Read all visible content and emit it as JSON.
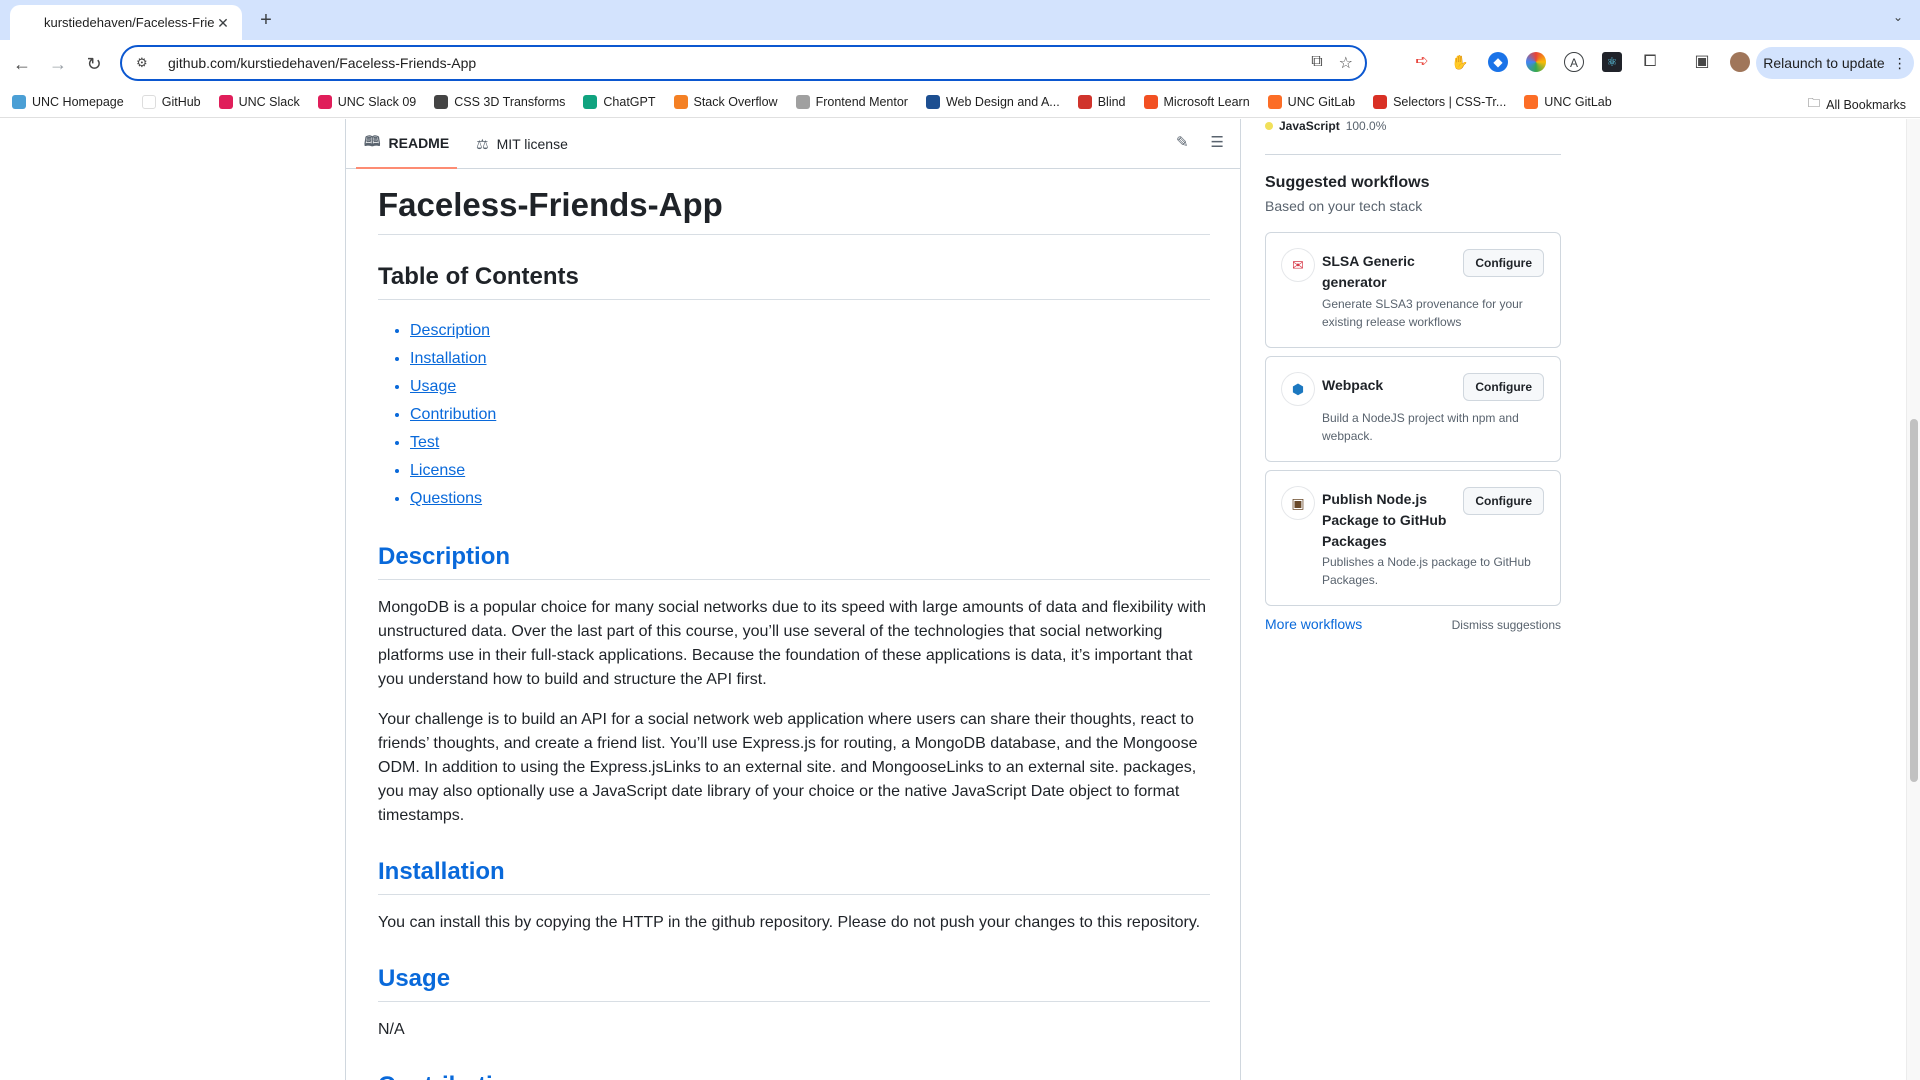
{
  "browser": {
    "tab_title": "kurstiedehaven/Faceless-Frie",
    "tab_close": "✕",
    "new_tab": "+",
    "url": "github.com/kurstiedehaven/Faceless-Friends-App",
    "relaunch_label": "Relaunch to update",
    "bookmarks": [
      {
        "label": "UNC Homepage",
        "color": "#4b9fd5"
      },
      {
        "label": "GitHub",
        "color": "#ffffff"
      },
      {
        "label": "UNC Slack",
        "color": "#e01e5a"
      },
      {
        "label": "UNC Slack 09",
        "color": "#e01e5a"
      },
      {
        "label": "CSS 3D Transforms",
        "color": "#444444"
      },
      {
        "label": "ChatGPT",
        "color": "#10a37f"
      },
      {
        "label": "Stack Overflow",
        "color": "#f48024"
      },
      {
        "label": "Frontend Mentor",
        "color": "#a0a0a0"
      },
      {
        "label": "Web Design and A...",
        "color": "#1d4f91"
      },
      {
        "label": "Blind",
        "color": "#d0342c"
      },
      {
        "label": "Microsoft Learn",
        "color": "#f25022"
      },
      {
        "label": "UNC GitLab",
        "color": "#fc6d26"
      },
      {
        "label": "Selectors | CSS-Tr...",
        "color": "#d93025"
      },
      {
        "label": "UNC GitLab",
        "color": "#fc6d26"
      }
    ],
    "all_bookmarks": "All Bookmarks"
  },
  "readme": {
    "tabs": [
      {
        "label": "README",
        "icon": "book-icon"
      },
      {
        "label": "MIT license",
        "icon": "scale-icon"
      }
    ],
    "title": "Faceless-Friends-App",
    "toc_heading": "Table of Contents",
    "toc": [
      "Description",
      "Installation",
      "Usage",
      "Contribution",
      "Test",
      "License",
      "Questions"
    ],
    "description_heading": "Description",
    "description_p1": "MongoDB is a popular choice for many social networks due to its speed with large amounts of data and flexibility with unstructured data. Over the last part of this course, you’ll use several of the technologies that social networking platforms use in their full-stack applications. Because the foundation of these applications is data, it’s important that you understand how to build and structure the API first.",
    "description_p2": "Your challenge is to build an API for a social network web application where users can share their thoughts, react to friends’ thoughts, and create a friend list. You’ll use Express.js for routing, a MongoDB database, and the Mongoose ODM. In addition to using the Express.jsLinks to an external site. and MongooseLinks to an external site. packages, you may also optionally use a JavaScript date library of your choice or the native JavaScript Date object to format timestamps.",
    "installation_heading": "Installation",
    "installation_p": "You can install this by copying the HTTP in the github repository. Please do not push your changes to this repository.",
    "usage_heading": "Usage",
    "usage_p": "N/A",
    "contribution_heading": "Contribution"
  },
  "sidebar": {
    "language": {
      "name": "JavaScript",
      "percent": "100.0%",
      "color": "#f1e05a"
    },
    "title": "Suggested workflows",
    "subtitle": "Based on your tech stack",
    "workflows": [
      {
        "name": "SLSA Generic generator",
        "description": "Generate SLSA3 provenance for your existing release workflows",
        "button": "Configure",
        "icon": "slsa-icon"
      },
      {
        "name": "Webpack",
        "description": "Build a NodeJS project with npm and webpack.",
        "button": "Configure",
        "icon": "webpack-icon"
      },
      {
        "name": "Publish Node.js Package to GitHub Packages",
        "description": "Publishes a Node.js package to GitHub Packages.",
        "button": "Configure",
        "icon": "package-icon"
      }
    ],
    "more_workflows": "More workflows",
    "dismiss": "Dismiss suggestions"
  }
}
